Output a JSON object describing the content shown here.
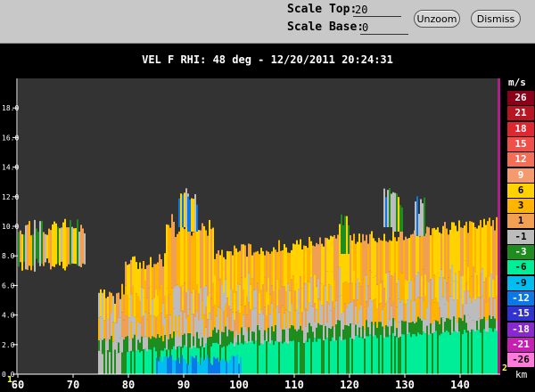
{
  "controls": {
    "scale_top_label": "Scale Top:",
    "scale_top_value": "20",
    "scale_base_label": "Scale Base:",
    "scale_base_value": "0",
    "unzoom_label": "Unzoom",
    "dismiss_label": "Dismiss"
  },
  "plot": {
    "title": "VEL F  RHI: 48 deg  -  12/20/2011 20:24:31",
    "x_unit": "km",
    "x_ticks": [
      "60",
      "70",
      "80",
      "90",
      "100",
      "110",
      "120",
      "130",
      "140"
    ],
    "y_ticks": [
      "0.0",
      "2.0",
      "4.0",
      "6.0",
      "8.0",
      "10.0",
      "12.0",
      "14.0",
      "16.0",
      "18.0"
    ],
    "corner_marker_left": "1",
    "corner_marker_right": "2"
  },
  "colorbar": {
    "unit": "m/s",
    "entries": [
      {
        "label": "26",
        "color": "#8b0018",
        "text": "#ffffff"
      },
      {
        "label": "21",
        "color": "#b81422",
        "text": "#ffffff"
      },
      {
        "label": "18",
        "color": "#e0262e",
        "text": "#ffffff"
      },
      {
        "label": "15",
        "color": "#f0504a",
        "text": "#ffffff"
      },
      {
        "label": "12",
        "color": "#f46e56",
        "text": "#ffffff"
      },
      {
        "label": "9",
        "color": "#f49a6c",
        "text": "#ffffff"
      },
      {
        "label": "6",
        "color": "#ffd200",
        "text": "#000000"
      },
      {
        "label": "3",
        "color": "#ffb400",
        "text": "#000000"
      },
      {
        "label": "1",
        "color": "#f0a050",
        "text": "#000000"
      },
      {
        "label": "-1",
        "color": "#bcbcbc",
        "text": "#000000"
      },
      {
        "label": "-3",
        "color": "#1e8c1e",
        "text": "#ffffff"
      },
      {
        "label": "-6",
        "color": "#00ee98",
        "text": "#000000"
      },
      {
        "label": "-9",
        "color": "#00bef0",
        "text": "#000000"
      },
      {
        "label": "-12",
        "color": "#0a78e8",
        "text": "#ffffff"
      },
      {
        "label": "-15",
        "color": "#3232d2",
        "text": "#ffffff"
      },
      {
        "label": "-18",
        "color": "#8a28d0",
        "text": "#ffffff"
      },
      {
        "label": "-21",
        "color": "#c81eb4",
        "text": "#ffffff"
      },
      {
        "label": "-26",
        "color": "#ff7adc",
        "text": "#000000"
      }
    ]
  }
}
